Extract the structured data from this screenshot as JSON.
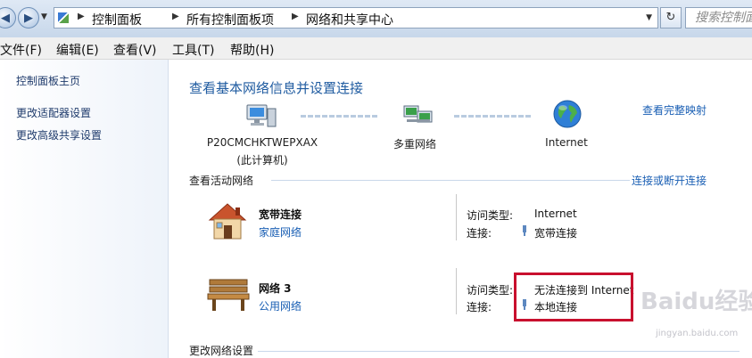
{
  "address_bar": {
    "breadcrumbs": [
      "控制面板",
      "所有控制面板项",
      "网络和共享中心"
    ],
    "search_placeholder": "搜索控制面板"
  },
  "menu": [
    "文件(F)",
    "编辑(E)",
    "查看(V)",
    "工具(T)",
    "帮助(H)"
  ],
  "sidebar": {
    "home": "控制面板主页",
    "items": [
      "更改适配器设置",
      "更改高级共享设置"
    ]
  },
  "main": {
    "title": "查看基本网络信息并设置连接",
    "full_map": "查看完整映射",
    "nodes": [
      {
        "name": "P20CMCHKTWEPXAX",
        "sub": "(此计算机)",
        "icon": "computer-icon"
      },
      {
        "name": "多重网络",
        "icon": "network-icon"
      },
      {
        "name": "Internet",
        "icon": "globe-icon"
      }
    ],
    "active_header": "查看活动网络",
    "connect_link": "连接或断开连接",
    "networks": [
      {
        "name": "宽带连接",
        "type": "家庭网络",
        "icon": "house-icon",
        "access_label": "访问类型:",
        "access_value": "Internet",
        "conn_label": "连接:",
        "conn_value": "宽带连接"
      },
      {
        "name": "网络  3",
        "type": "公用网络",
        "icon": "bench-icon",
        "access_label": "访问类型:",
        "access_value": "无法连接到 Internet",
        "conn_label": "连接:",
        "conn_value": "本地连接"
      }
    ],
    "change_header": "更改网络设置"
  },
  "colors": {
    "highlight_box": "#c8102e",
    "link": "#1a5fb4",
    "title": "#1f5ba0"
  },
  "watermark": {
    "text": "Baidu经验",
    "sub": "jingyan.baidu.com"
  }
}
